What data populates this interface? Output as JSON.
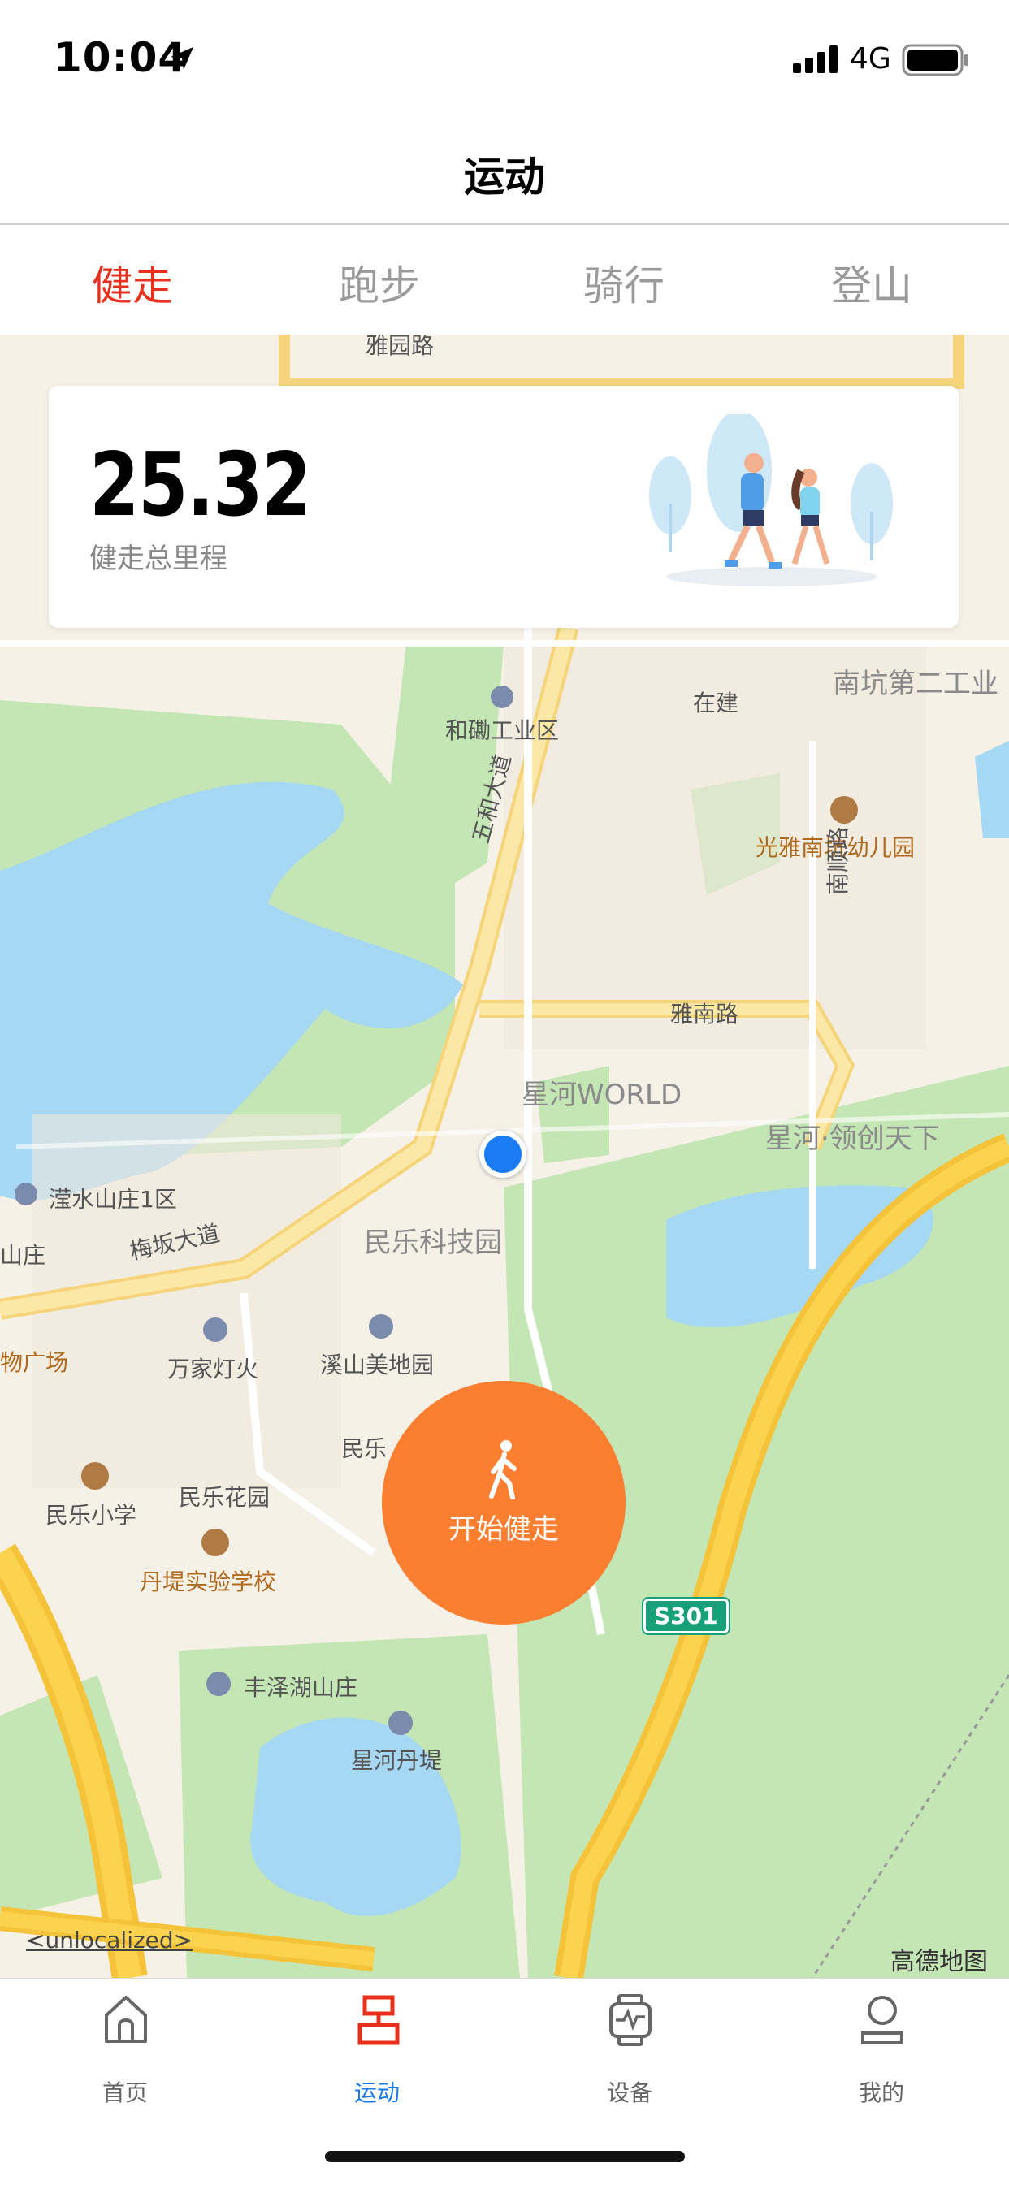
{
  "status_bar": {
    "time": "10:04",
    "network": "4G"
  },
  "nav": {
    "title": "运动"
  },
  "tabs": [
    {
      "label": "健走",
      "active": true
    },
    {
      "label": "跑步",
      "active": false
    },
    {
      "label": "骑行",
      "active": false
    },
    {
      "label": "登山",
      "active": false
    }
  ],
  "card": {
    "value": "25.32",
    "label": "健走总里程"
  },
  "map": {
    "labels": [
      "雅园路",
      "南坑第二工业",
      "在建",
      "和磡工业区",
      "光雅南坑幼儿园",
      "五和大道",
      "南顺路",
      "雅南路",
      "星河WORLD",
      "星河·领创天下",
      "滢水山庄1区",
      "山庄",
      "梅坂大道",
      "民乐科技园",
      "物广场",
      "万家灯火",
      "溪山美地园",
      "民乐",
      "民乐小学",
      "民乐花园",
      "丹堤实验学校",
      "丰泽湖山庄",
      "星河丹堤",
      "S301",
      "<unlocalized>",
      "高德地图"
    ]
  },
  "start_button": {
    "label": "开始健走"
  },
  "tab_bar": [
    {
      "label": "首页",
      "icon": "home-icon",
      "active": false
    },
    {
      "label": "运动",
      "icon": "sport-icon",
      "active": true
    },
    {
      "label": "设备",
      "icon": "device-icon",
      "active": false
    },
    {
      "label": "我的",
      "icon": "profile-icon",
      "active": false
    }
  ],
  "colors": {
    "accent_red": "#e8301e",
    "accent_blue": "#1a7be6",
    "start_orange": "#fb7e31",
    "location_blue": "#1a7cf5"
  }
}
